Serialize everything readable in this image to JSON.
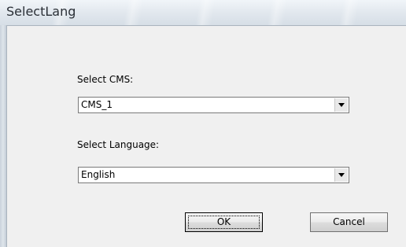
{
  "window": {
    "title": "SelectLang"
  },
  "form": {
    "cms_label": "Select CMS:",
    "cms_value": "CMS_1",
    "language_label": "Select Language:",
    "language_value": "English"
  },
  "buttons": {
    "ok": "OK",
    "cancel": "Cancel"
  },
  "icons": {
    "dropdown": "chevron-down-icon"
  }
}
